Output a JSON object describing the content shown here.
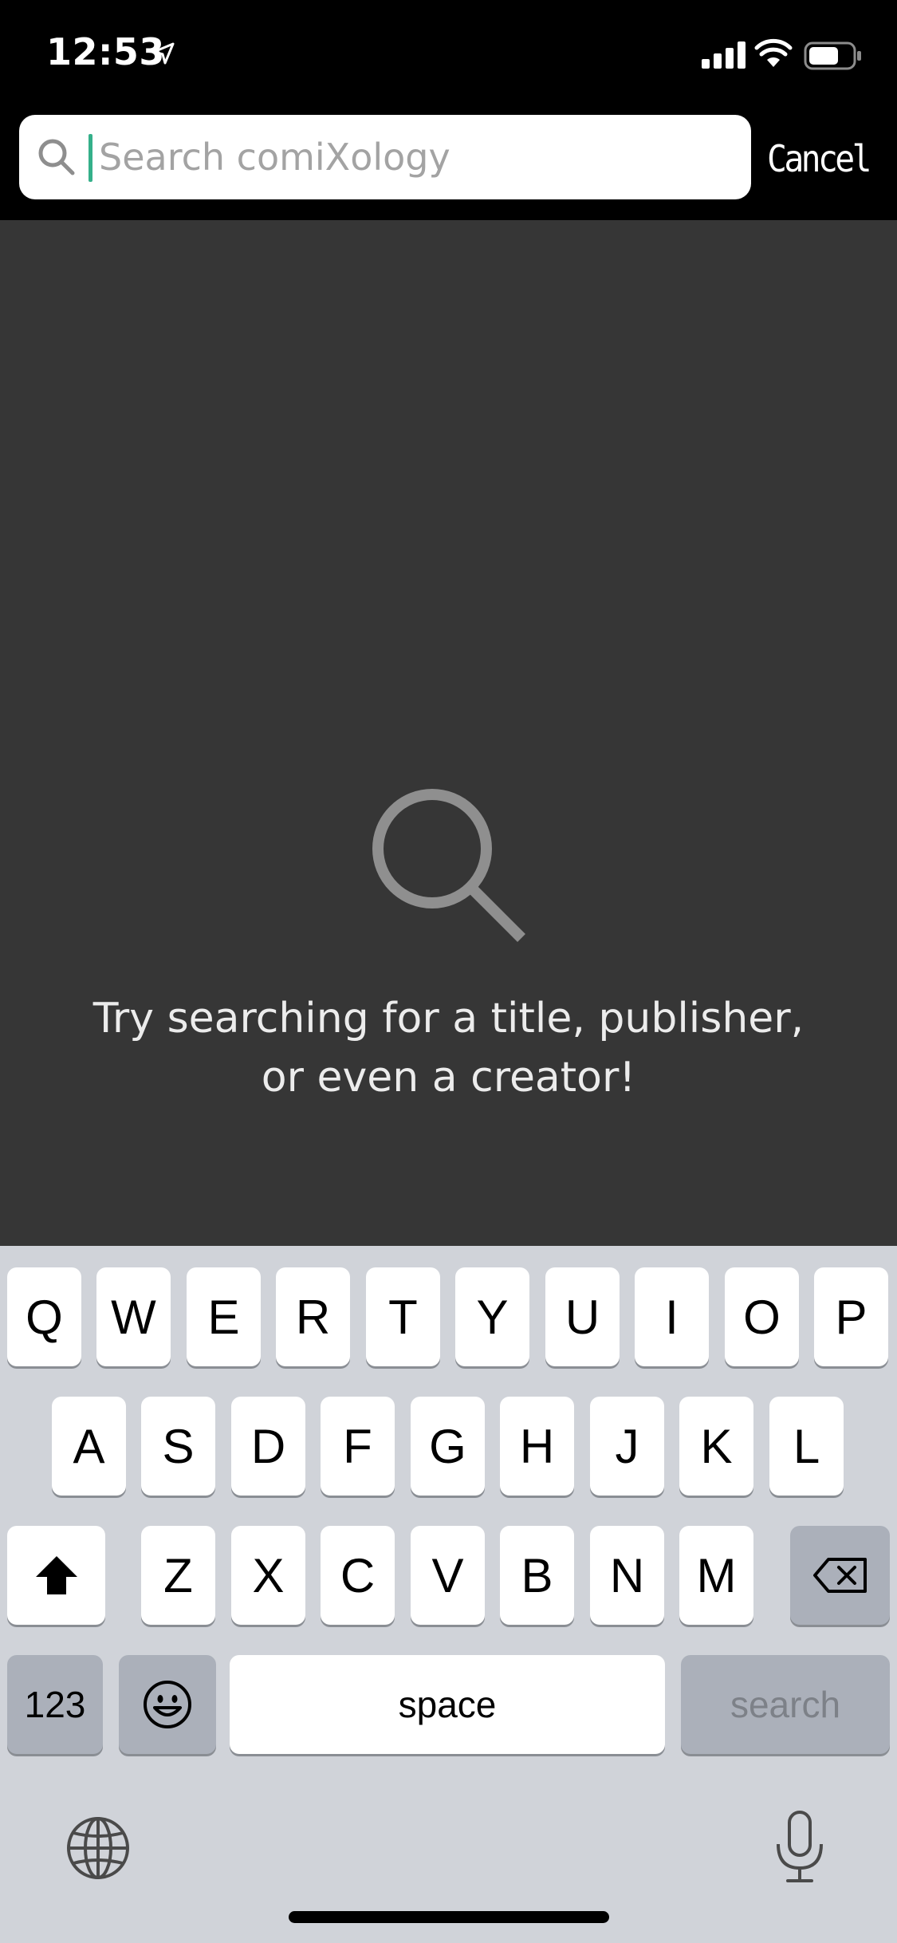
{
  "status_bar": {
    "time": "12:53"
  },
  "search": {
    "placeholder": "Search comiXology",
    "value": "",
    "cancel_label": "Cancel"
  },
  "empty_state": {
    "line1": "Try searching for a title, publisher,",
    "line2": "or even a creator!"
  },
  "keyboard": {
    "row1": [
      "Q",
      "W",
      "E",
      "R",
      "T",
      "Y",
      "U",
      "I",
      "O",
      "P"
    ],
    "row2": [
      "A",
      "S",
      "D",
      "F",
      "G",
      "H",
      "J",
      "K",
      "L"
    ],
    "row3": [
      "Z",
      "X",
      "C",
      "V",
      "B",
      "N",
      "M"
    ],
    "numbers_label": "123",
    "space_label": "space",
    "search_label": "search"
  },
  "colors": {
    "accent_cursor": "#35b08a",
    "content_bg": "#363636",
    "keyboard_bg": "#d0d3d9"
  },
  "icons": [
    "location-arrow-icon",
    "signal-icon",
    "wifi-icon",
    "battery-icon",
    "search-icon",
    "shift-icon",
    "backspace-icon",
    "emoji-icon",
    "globe-icon",
    "microphone-icon"
  ]
}
